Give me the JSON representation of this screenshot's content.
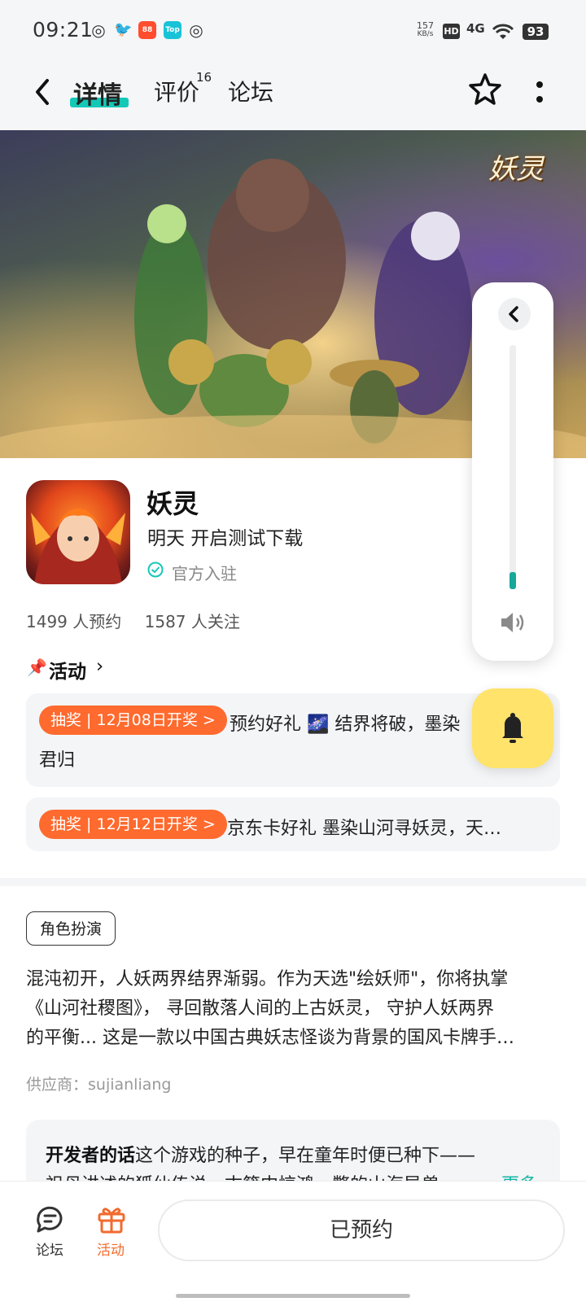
{
  "status_bar": {
    "time": "09:21",
    "app_icons": [
      "weibo-icon",
      "bird-icon",
      "red-app-icon",
      "top-app-icon",
      "weibo-icon"
    ],
    "net_speed_value": "157",
    "net_speed_unit": "KB/s",
    "hd": "HD",
    "network": "4G",
    "battery": "93"
  },
  "nav": {
    "tabs": [
      {
        "label": "详情",
        "active": true
      },
      {
        "label": "评价",
        "badge": "16"
      },
      {
        "label": "论坛"
      }
    ]
  },
  "banner": {
    "logo_text": "妖灵"
  },
  "game": {
    "name": "妖灵",
    "subtitle": "明天 开启测试下载",
    "verified": "官方入驻",
    "reservations": "1499 人预约",
    "followers": "1587 人关注"
  },
  "activities": {
    "title": "活动",
    "items": [
      {
        "pill": "抽奖 | 12月08日开奖 >",
        "text": "预约好礼 🌌 结界将破，墨染",
        "text_line2": "君归"
      },
      {
        "pill": "抽奖 | 12月12日开奖 >",
        "text": "京东卡好礼 墨染山河寻妖灵，天…"
      }
    ]
  },
  "description": {
    "genre": "角色扮演",
    "lines": [
      "混沌初开，人妖两界结界渐弱。作为天选\"绘妖师\"，你将执掌",
      "《山河社稷图》， 寻回散落人间的上古妖灵， 守护人妖两界",
      "的平衡... 这是一款以中国古典妖志怪谈为背景的国风卡牌手…"
    ],
    "supplier": "供应商：sujianliang"
  },
  "developer_note": {
    "label": "开发者的话",
    "text": "这个游戏的种子，早在童年时便已种下——",
    "text_line2": "祖母讲述的狐仙传说，古籍中惊鸿一瞥的山海异兽",
    "more": "更多"
  },
  "bottom_bar": {
    "forum_label": "论坛",
    "activity_label": "活动",
    "reserve_button": "已预约",
    "activity_color": "#f26b2e"
  },
  "volume": {
    "level": 0.07
  },
  "colors": {
    "accent": "#14c8b6",
    "pill": "#ff6a2e",
    "bell": "#ffe36b"
  }
}
